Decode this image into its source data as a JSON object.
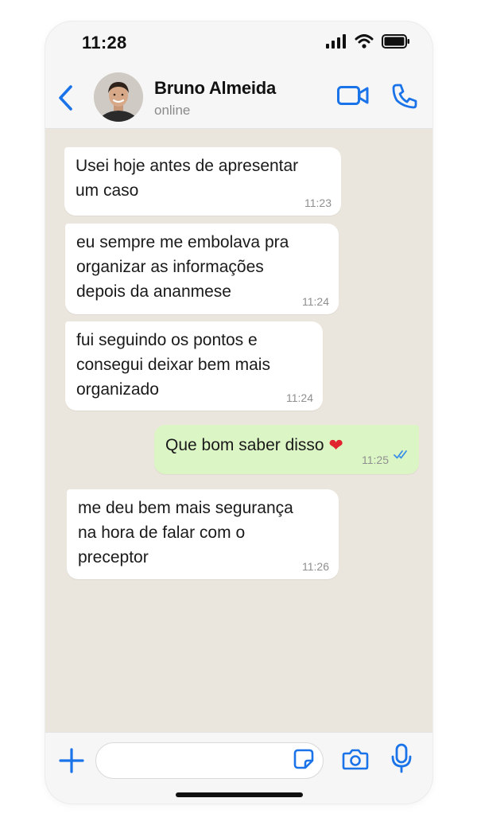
{
  "status_bar": {
    "time": "11:28"
  },
  "header": {
    "contact_name": "Bruno Almeida",
    "contact_status": "online",
    "icons": {
      "back": "chevron-left-icon",
      "video": "video-call-icon",
      "call": "phone-icon"
    }
  },
  "messages": [
    {
      "direction": "in",
      "text": "Usei hoje antes de apresentar\num caso",
      "time": "11:23"
    },
    {
      "direction": "in",
      "text": "eu sempre me embolava pra\norganizar as informações\ndepois da ananmese",
      "time": "11:24"
    },
    {
      "direction": "in",
      "text": "fui seguindo os pontos e\nconsegui deixar bem mais\norganizado",
      "time": "11:24"
    },
    {
      "direction": "out",
      "text": "Que bom saber disso",
      "emoji": "❤",
      "time": "11:25",
      "status": "read"
    },
    {
      "direction": "in",
      "text": "me deu bem mais segurança\nna hora de falar com o\npreceptor",
      "time": "11:26"
    }
  ],
  "input_bar": {
    "placeholder": "",
    "icons": {
      "plus": "plus-icon",
      "sticker": "sticker-icon",
      "camera": "camera-icon",
      "mic": "microphone-icon"
    }
  },
  "colors": {
    "accent": "#1a73e8",
    "chat_background": "#ebe6dd",
    "incoming_bubble": "#ffffff",
    "outgoing_bubble": "#dcf5c5",
    "read_ticks": "#3a8fe6"
  }
}
